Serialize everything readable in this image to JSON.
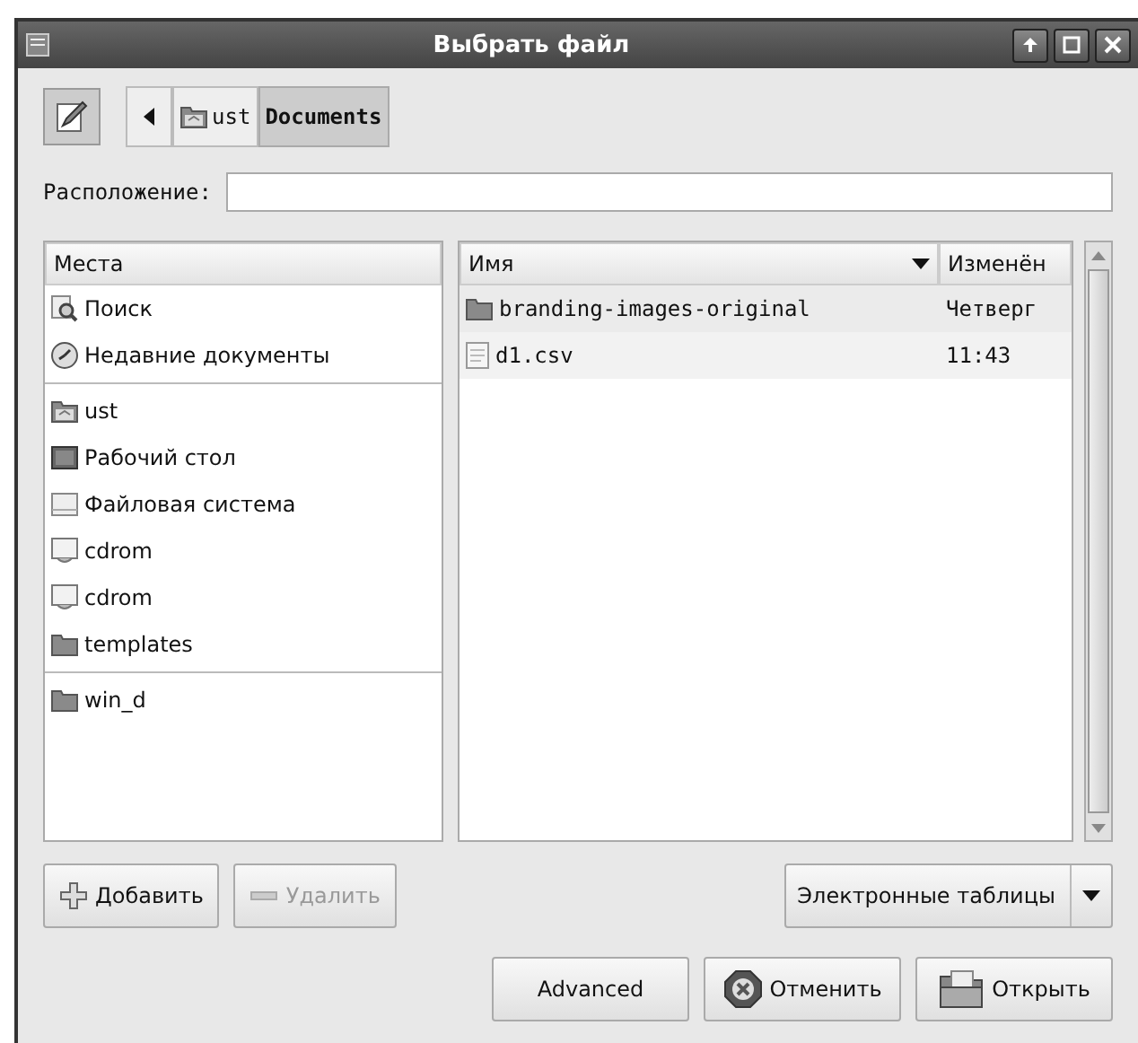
{
  "window": {
    "title": "Выбрать файл"
  },
  "path_bar": [
    {
      "label": "ust",
      "kind": "home",
      "selected": false
    },
    {
      "label": "Documents",
      "kind": "plain",
      "selected": true
    }
  ],
  "location": {
    "label": "Расположение:"
  },
  "places": {
    "heading": "Места",
    "groups": [
      [
        {
          "label": "Поиск",
          "kind": "search"
        },
        {
          "label": "Недавние документы",
          "kind": "recent"
        }
      ],
      [
        {
          "label": "ust",
          "kind": "home"
        },
        {
          "label": "Рабочий стол",
          "kind": "desktop"
        },
        {
          "label": "Файловая система",
          "kind": "drive"
        },
        {
          "label": "cdrom",
          "kind": "cdrom"
        },
        {
          "label": "cdrom",
          "kind": "cdrom"
        },
        {
          "label": "templates",
          "kind": "folder"
        }
      ],
      [
        {
          "label": "win_d",
          "kind": "folder"
        }
      ]
    ]
  },
  "files": {
    "columns": [
      "Имя",
      "Изменён"
    ],
    "rows": [
      {
        "name": "branding-images-original",
        "modified": "Четверг",
        "kind": "folder"
      },
      {
        "name": "d1.csv",
        "modified": "11:43",
        "kind": "file"
      }
    ]
  },
  "place_buttons": [
    {
      "label": "Добавить",
      "kind": "add",
      "disabled": false
    },
    {
      "label": "Удалить",
      "kind": "remove",
      "disabled": true
    }
  ],
  "filter": {
    "value": "Электронные таблицы"
  },
  "buttons": [
    {
      "label": "Advanced",
      "kind": "plain"
    },
    {
      "label": "Отменить",
      "kind": "cancel"
    },
    {
      "label": "Открыть",
      "kind": "open"
    }
  ]
}
